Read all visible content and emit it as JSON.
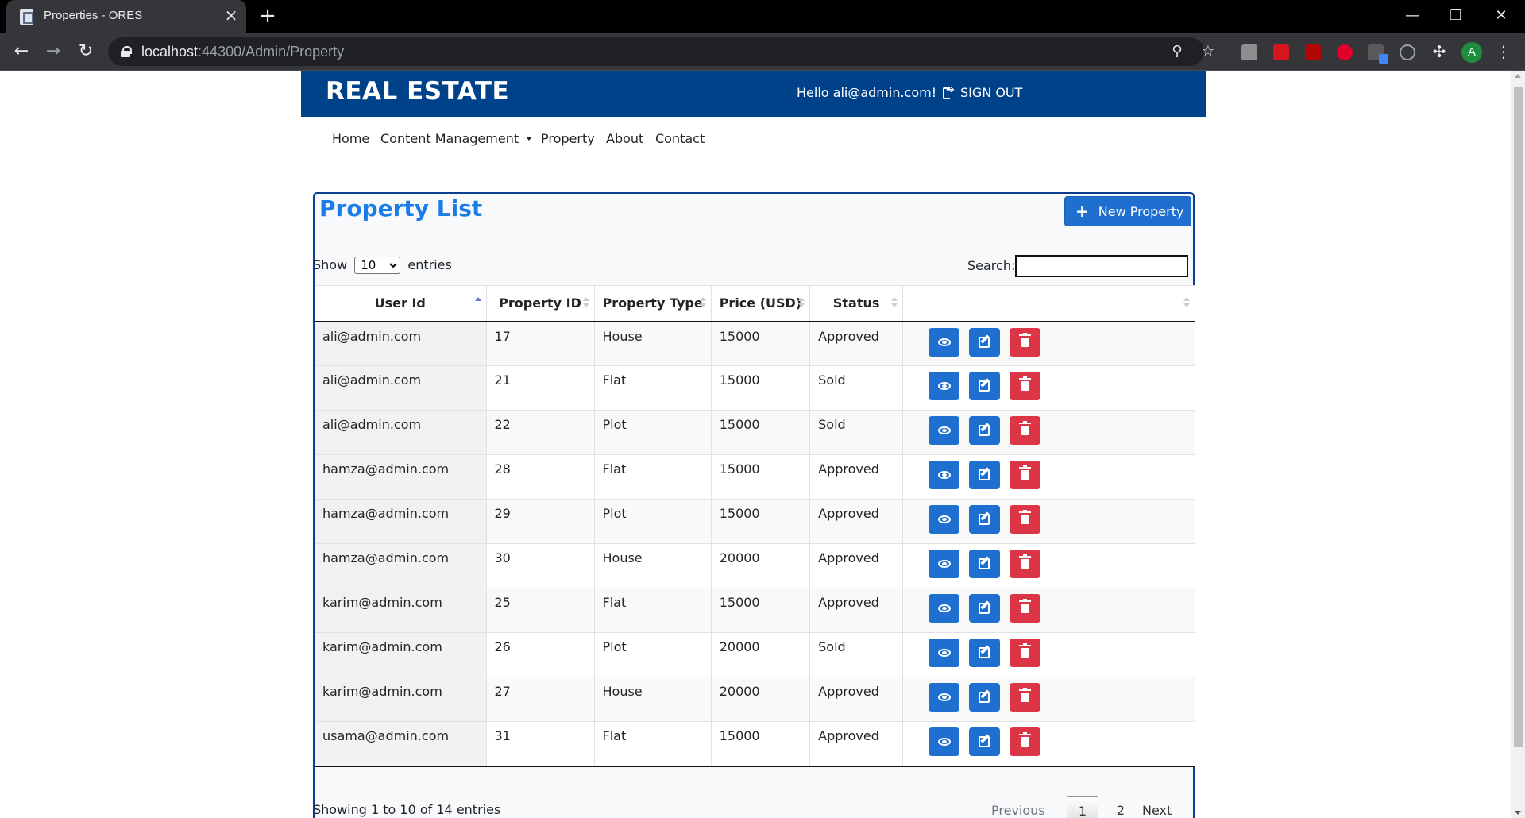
{
  "browser": {
    "tab_title": "Properties - ORES",
    "url_host": "localhost",
    "url_rest": ":44300/Admin/Property",
    "profile_initial": "A"
  },
  "header": {
    "brand": "REAL ESTATE",
    "greeting": "Hello ali@admin.com!",
    "signout_label": "SIGN OUT"
  },
  "nav": {
    "home": "Home",
    "content_management": "Content Management",
    "property": "Property",
    "about": "About",
    "contact": "Contact"
  },
  "card": {
    "title": "Property List",
    "new_button": "New Property"
  },
  "table_controls": {
    "show_label": "Show",
    "page_length": "10",
    "entries_label": "entries",
    "search_label": "Search:",
    "search_value": ""
  },
  "columns": [
    "User Id",
    "Property ID",
    "Property Type",
    "Price (USD)",
    "Status",
    ""
  ],
  "rows": [
    {
      "user": "ali@admin.com",
      "id": "17",
      "type": "House",
      "price": "15000",
      "status": "Approved"
    },
    {
      "user": "ali@admin.com",
      "id": "21",
      "type": "Flat",
      "price": "15000",
      "status": "Sold"
    },
    {
      "user": "ali@admin.com",
      "id": "22",
      "type": "Plot",
      "price": "15000",
      "status": "Sold"
    },
    {
      "user": "hamza@admin.com",
      "id": "28",
      "type": "Flat",
      "price": "15000",
      "status": "Approved"
    },
    {
      "user": "hamza@admin.com",
      "id": "29",
      "type": "Plot",
      "price": "15000",
      "status": "Approved"
    },
    {
      "user": "hamza@admin.com",
      "id": "30",
      "type": "House",
      "price": "20000",
      "status": "Approved"
    },
    {
      "user": "karim@admin.com",
      "id": "25",
      "type": "Flat",
      "price": "15000",
      "status": "Approved"
    },
    {
      "user": "karim@admin.com",
      "id": "26",
      "type": "Plot",
      "price": "20000",
      "status": "Sold"
    },
    {
      "user": "karim@admin.com",
      "id": "27",
      "type": "House",
      "price": "20000",
      "status": "Approved"
    },
    {
      "user": "usama@admin.com",
      "id": "31",
      "type": "Flat",
      "price": "15000",
      "status": "Approved"
    }
  ],
  "footer": {
    "info": "Showing 1 to 10 of 14 entries",
    "previous": "Previous",
    "page1": "1",
    "page2": "2",
    "next": "Next"
  },
  "colors": {
    "header_bg": "#00428a",
    "primary_button": "#1f6fd1",
    "danger_button": "#dc3545",
    "title_blue": "#1a7ce8"
  }
}
